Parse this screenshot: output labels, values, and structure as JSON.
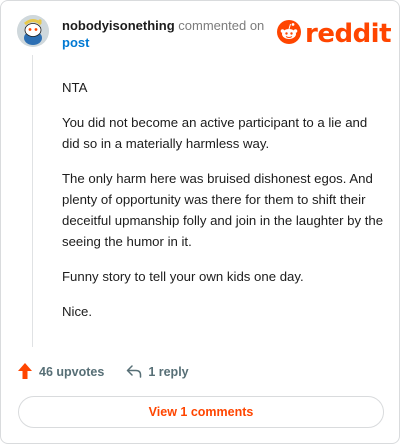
{
  "comment": {
    "username": "nobodyisonething",
    "action_text": "commented on",
    "post_link": "post",
    "paragraphs": [
      "NTA",
      "You did not become an active participant to a lie and did so in a materially harmless way.",
      "The only harm here was bruised dishonest egos. And plenty of opportunity was there for them to shift their deceitful upmanship folly and join in the laughter by the seeing the humor in it.",
      "Funny story to tell your own kids one day.",
      "Nice."
    ],
    "upvotes_label": "46 upvotes",
    "replies_label": "1 reply",
    "view_comments_label": "View 1 comments"
  },
  "brand": {
    "logo_text": "reddit",
    "accent_color": "#ff4500",
    "link_color": "#0079d3"
  },
  "icons": {
    "avatar": "snoo-avatar-icon",
    "logo": "reddit-snoo-icon",
    "upvote": "upvote-arrow-icon",
    "reply": "reply-arrow-icon"
  }
}
